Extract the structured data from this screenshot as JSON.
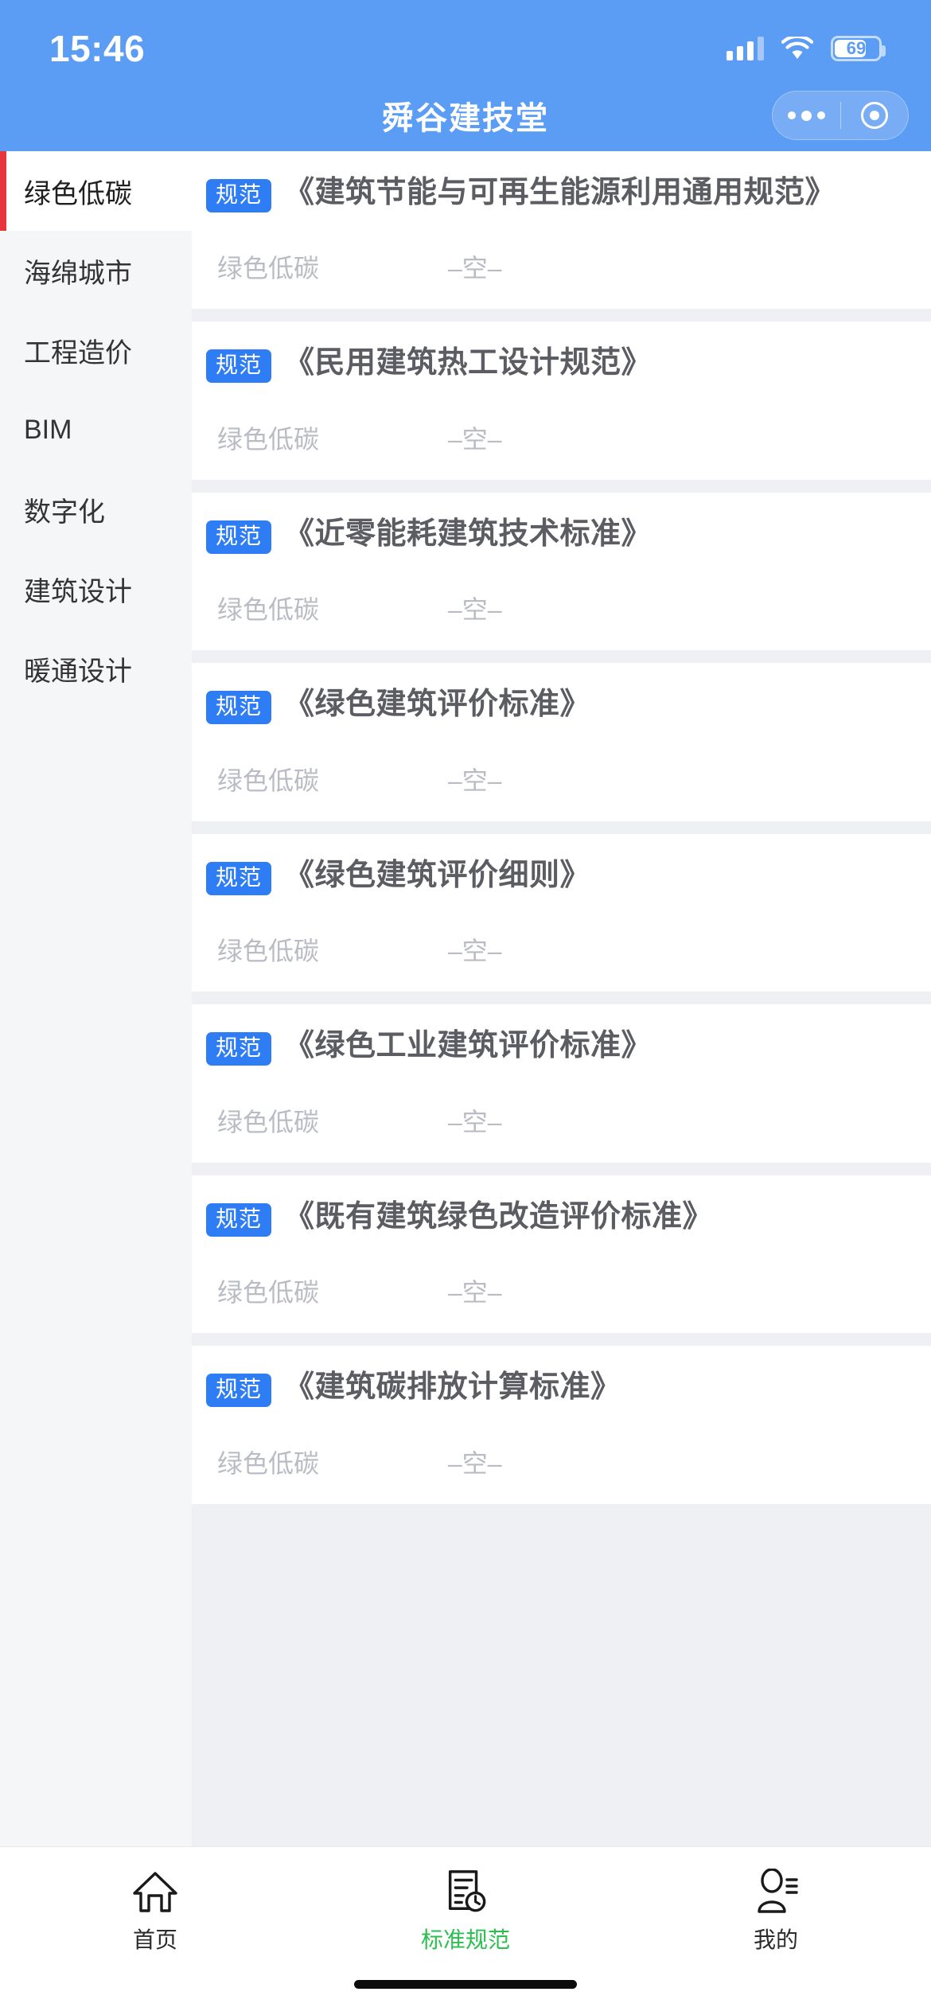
{
  "status_bar": {
    "time": "15:46",
    "battery_percent": "69",
    "signal_icon": "cellular-signal-icon",
    "wifi_icon": "wifi-icon",
    "battery_icon": "battery-icon"
  },
  "header": {
    "title": "舜谷建技堂",
    "capsule": {
      "more_icon": "more-dots-icon",
      "target_icon": "target-circle-icon"
    }
  },
  "sidebar": {
    "items": [
      {
        "label": "绿色低碳",
        "active": true
      },
      {
        "label": "海绵城市",
        "active": false
      },
      {
        "label": "工程造价",
        "active": false
      },
      {
        "label": "BIM",
        "active": false
      },
      {
        "label": "数字化",
        "active": false
      },
      {
        "label": "建筑设计",
        "active": false
      },
      {
        "label": "暖通设计",
        "active": false
      }
    ]
  },
  "list": {
    "cards": [
      {
        "badge": "规范",
        "title": "《建筑节能与可再生能源利用通用规范》",
        "category": "绿色低碳",
        "value": "–空–"
      },
      {
        "badge": "规范",
        "title": "《民用建筑热工设计规范》",
        "category": "绿色低碳",
        "value": "–空–"
      },
      {
        "badge": "规范",
        "title": "《近零能耗建筑技术标准》",
        "category": "绿色低碳",
        "value": "–空–"
      },
      {
        "badge": "规范",
        "title": "《绿色建筑评价标准》",
        "category": "绿色低碳",
        "value": "–空–"
      },
      {
        "badge": "规范",
        "title": "《绿色建筑评价细则》",
        "category": "绿色低碳",
        "value": "–空–"
      },
      {
        "badge": "规范",
        "title": "《绿色工业建筑评价标准》",
        "category": "绿色低碳",
        "value": "–空–"
      },
      {
        "badge": "规范",
        "title": "《既有建筑绿色改造评价标准》",
        "category": "绿色低碳",
        "value": "–空–"
      },
      {
        "badge": "规范",
        "title": "《建筑碳排放计算标准》",
        "category": "绿色低碳",
        "value": "–空–"
      }
    ]
  },
  "tabbar": {
    "tabs": [
      {
        "label": "首页",
        "icon": "home-icon",
        "active": false
      },
      {
        "label": "标准规范",
        "icon": "document-clock-icon",
        "active": true
      },
      {
        "label": "我的",
        "icon": "user-profile-icon",
        "active": false
      }
    ]
  },
  "colors": {
    "header_blue": "#5b9cf5",
    "badge_blue": "#2f7df4",
    "active_indicator_red": "#e8343c",
    "tab_active_green": "#2bbf4e",
    "page_bg": "#eef0f3",
    "sidebar_bg": "#f5f6f8"
  }
}
